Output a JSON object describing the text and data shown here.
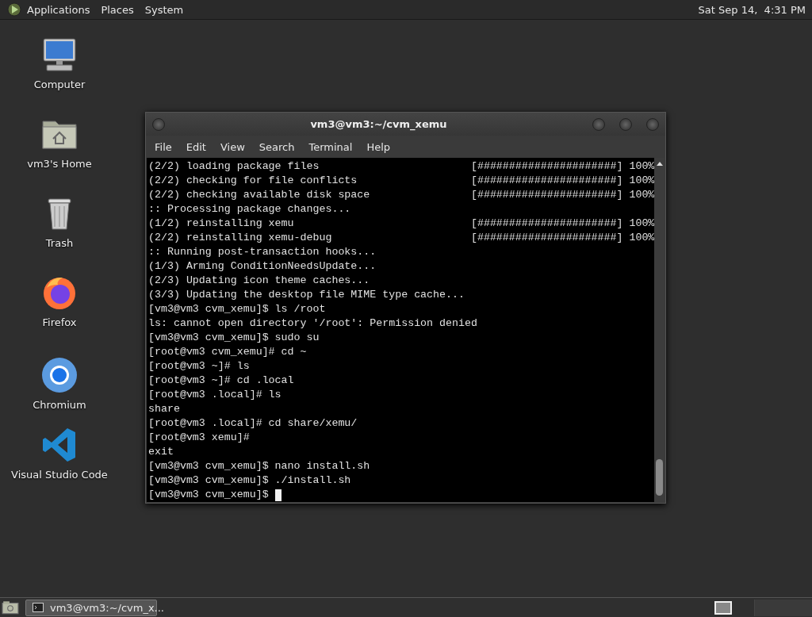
{
  "top_panel": {
    "menus": [
      "Applications",
      "Places",
      "System"
    ],
    "clock": "Sat Sep 14,  4:31 PM"
  },
  "desktop_icons": [
    {
      "label": "Computer",
      "kind": "computer"
    },
    {
      "label": "vm3's Home",
      "kind": "home"
    },
    {
      "label": "Trash",
      "kind": "trash"
    },
    {
      "label": "Firefox",
      "kind": "firefox"
    },
    {
      "label": "Chromium",
      "kind": "chromium"
    },
    {
      "label": "Visual Studio Code",
      "kind": "vscode"
    }
  ],
  "window": {
    "title": "vm3@vm3:~/cvm_xemu",
    "menus": [
      "File",
      "Edit",
      "View",
      "Search",
      "Terminal",
      "Help"
    ],
    "terminal": {
      "cursor": true,
      "lines": [
        {
          "kind": "progress",
          "text": "(2/2) loading package files",
          "bar": "[######################]",
          "percent": "100%"
        },
        {
          "kind": "progress",
          "text": "(2/2) checking for file conflicts",
          "bar": "[######################]",
          "percent": "100%"
        },
        {
          "kind": "progress",
          "text": "(2/2) checking available disk space",
          "bar": "[######################]",
          "percent": "100%"
        },
        {
          "kind": "text",
          "text": ":: Processing package changes..."
        },
        {
          "kind": "progress",
          "text": "(1/2) reinstalling xemu",
          "bar": "[######################]",
          "percent": "100%"
        },
        {
          "kind": "progress",
          "text": "(2/2) reinstalling xemu-debug",
          "bar": "[######################]",
          "percent": "100%"
        },
        {
          "kind": "text",
          "text": ":: Running post-transaction hooks..."
        },
        {
          "kind": "text",
          "text": "(1/3) Arming ConditionNeedsUpdate..."
        },
        {
          "kind": "text",
          "text": "(2/3) Updating icon theme caches..."
        },
        {
          "kind": "text",
          "text": "(3/3) Updating the desktop file MIME type cache..."
        },
        {
          "kind": "text",
          "text": "[vm3@vm3 cvm_xemu]$ ls /root"
        },
        {
          "kind": "text",
          "text": "ls: cannot open directory '/root': Permission denied"
        },
        {
          "kind": "text",
          "text": "[vm3@vm3 cvm_xemu]$ sudo su"
        },
        {
          "kind": "text",
          "text": "[root@vm3 cvm_xemu]# cd ~"
        },
        {
          "kind": "text",
          "text": "[root@vm3 ~]# ls"
        },
        {
          "kind": "text",
          "text": "[root@vm3 ~]# cd .local"
        },
        {
          "kind": "text",
          "text": "[root@vm3 .local]# ls"
        },
        {
          "kind": "text",
          "text": "share"
        },
        {
          "kind": "text",
          "text": "[root@vm3 .local]# cd share/xemu/"
        },
        {
          "kind": "text",
          "text": "[root@vm3 xemu]#"
        },
        {
          "kind": "text",
          "text": "exit"
        },
        {
          "kind": "text",
          "text": "[vm3@vm3 cvm_xemu]$ nano install.sh"
        },
        {
          "kind": "text",
          "text": "[vm3@vm3 cvm_xemu]$ ./install.sh"
        },
        {
          "kind": "text",
          "text": "[vm3@vm3 cvm_xemu]$ "
        }
      ]
    }
  },
  "taskbar": {
    "tasks": [
      {
        "label": "vm3@vm3:~/cvm_x...",
        "selected": true
      }
    ]
  }
}
